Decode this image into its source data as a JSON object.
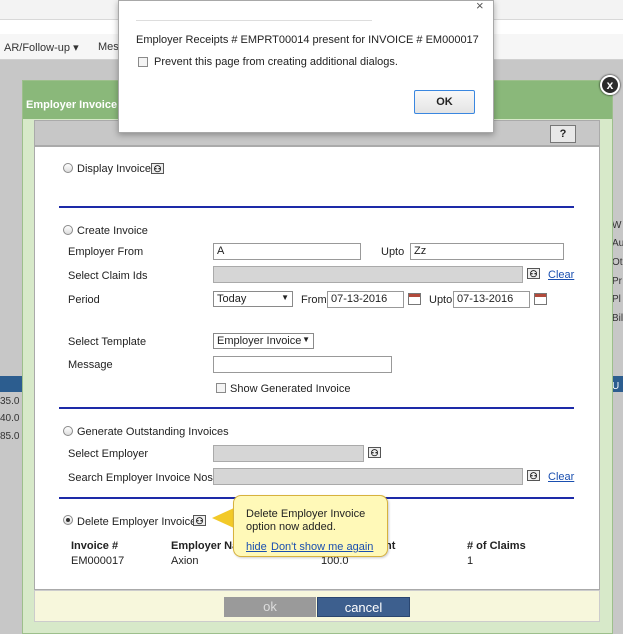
{
  "background": {
    "nav_items": [
      "AR/Follow-up ▾",
      "Mes"
    ],
    "left_values": [
      "35.0",
      "40.0",
      "85.0"
    ],
    "right_labels": [
      "W",
      "Au",
      "Ot",
      "Pr",
      "Pl",
      "Bil",
      "U"
    ]
  },
  "modal": {
    "title": "Employer Invoice R",
    "close_label": "x",
    "help_label": "?",
    "display_invoice": {
      "label": "Display Invoice"
    },
    "create_invoice": {
      "label": "Create Invoice",
      "employer_from_label": "Employer From",
      "employer_from_value": "A",
      "upto_label": "Upto",
      "upto_value": "Zz",
      "select_claim_ids_label": "Select Claim Ids",
      "clear_label": "Clear",
      "period_label": "Period",
      "period_value": "Today",
      "from_label": "From",
      "from_value": "07-13-2016",
      "period_upto_label": "Upto",
      "period_upto_value": "07-13-2016",
      "select_template_label": "Select Template",
      "template_value": "Employer Invoice",
      "message_label": "Message",
      "message_value": "",
      "show_generated_label": "Show Generated Invoice"
    },
    "generate_outstanding": {
      "label": "Generate Outstanding Invoices",
      "select_employer_label": "Select Employer",
      "search_nos_label": "Search Employer Invoice Nos",
      "clear_label": "Clear"
    },
    "delete_invoice": {
      "label": "Delete Employer Invoice",
      "columns": [
        "Invoice #",
        "Employer Na",
        "nt",
        "# of Claims"
      ],
      "rows": [
        [
          "EM000017",
          "Axion",
          "100.0",
          "1"
        ]
      ]
    },
    "tooltip": {
      "text": "Delete Employer Invoice option now added.",
      "hide_label": "hide",
      "dont_show_label": "Don't show me again"
    },
    "ok_label": "ok",
    "cancel_label": "cancel"
  },
  "alert": {
    "message": "Employer Receipts # EMPRT00014 present for INVOICE # EM000017",
    "checkbox_label": "Prevent this page from creating additional dialogs.",
    "ok_label": "OK",
    "close_label": "×"
  }
}
